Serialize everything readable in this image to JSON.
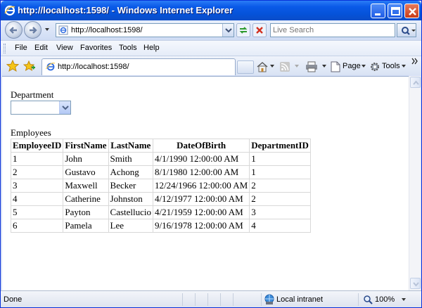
{
  "window": {
    "title": "http://localhost:1598/ - Windows Internet Explorer"
  },
  "address_bar": {
    "url": "http://localhost:1598/",
    "search_placeholder": "Live Search"
  },
  "menu": {
    "items": [
      "File",
      "Edit",
      "View",
      "Favorites",
      "Tools",
      "Help"
    ]
  },
  "tab": {
    "label": "http://localhost:1598/"
  },
  "commands": {
    "page_label": "Page",
    "tools_label": "Tools"
  },
  "page": {
    "department_label": "Department",
    "department_selected": "",
    "employees_label": "Employees",
    "columns": [
      "EmployeeID",
      "FirstName",
      "LastName",
      "DateOfBirth",
      "DepartmentID"
    ],
    "rows": [
      [
        "1",
        "John",
        "Smith",
        "4/1/1990 12:00:00 AM",
        "1"
      ],
      [
        "2",
        "Gustavo",
        "Achong",
        "8/1/1980 12:00:00 AM",
        "1"
      ],
      [
        "3",
        "Maxwell",
        "Becker",
        "12/24/1966 12:00:00 AM",
        "2"
      ],
      [
        "4",
        "Catherine",
        "Johnston",
        "4/12/1977 12:00:00 AM",
        "2"
      ],
      [
        "5",
        "Payton",
        "Castellucio",
        "4/21/1959 12:00:00 AM",
        "3"
      ],
      [
        "6",
        "Pamela",
        "Lee",
        "9/16/1978 12:00:00 AM",
        "4"
      ]
    ]
  },
  "status": {
    "text": "Done",
    "zone": "Local intranet",
    "zoom": "100%"
  },
  "colors": {
    "titlebar": "#0552d8",
    "frame": "#d6dff7",
    "close_button": "#c93b17"
  }
}
